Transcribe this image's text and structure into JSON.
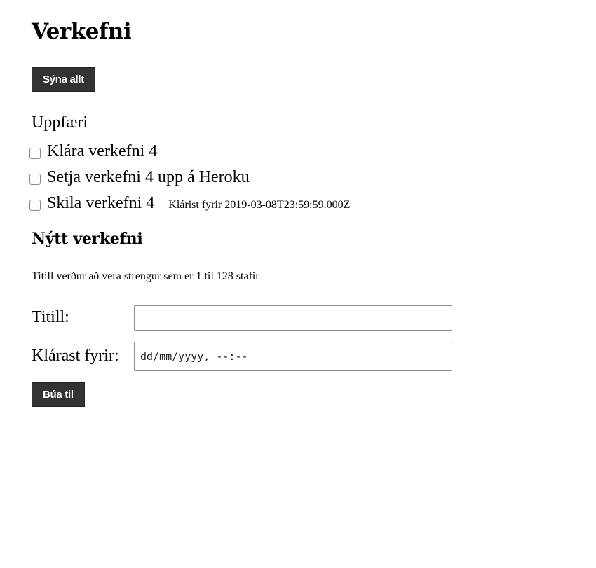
{
  "header": {
    "title": "Verkefni",
    "show_all_label": "Sýna allt"
  },
  "status": {
    "text": "Uppfæri"
  },
  "tasks": [
    {
      "label": "Klára verkefni 4",
      "checked": false,
      "due": ""
    },
    {
      "label": "Setja verkefni 4 upp á Heroku",
      "checked": false,
      "due": ""
    },
    {
      "label": "Skila verkefni 4",
      "checked": false,
      "due": "Klárist fyrir 2019-03-08T23:59:59.000Z"
    }
  ],
  "new_task": {
    "title": "Nýtt verkefni",
    "hint": "Titill verður að vera strengur sem er 1 til 128 stafir",
    "title_label": "Titill:",
    "title_value": "",
    "due_label": "Klárast fyrir:",
    "due_placeholder": "dd/mm/yyyy, --:--",
    "submit_label": "Búa til"
  }
}
